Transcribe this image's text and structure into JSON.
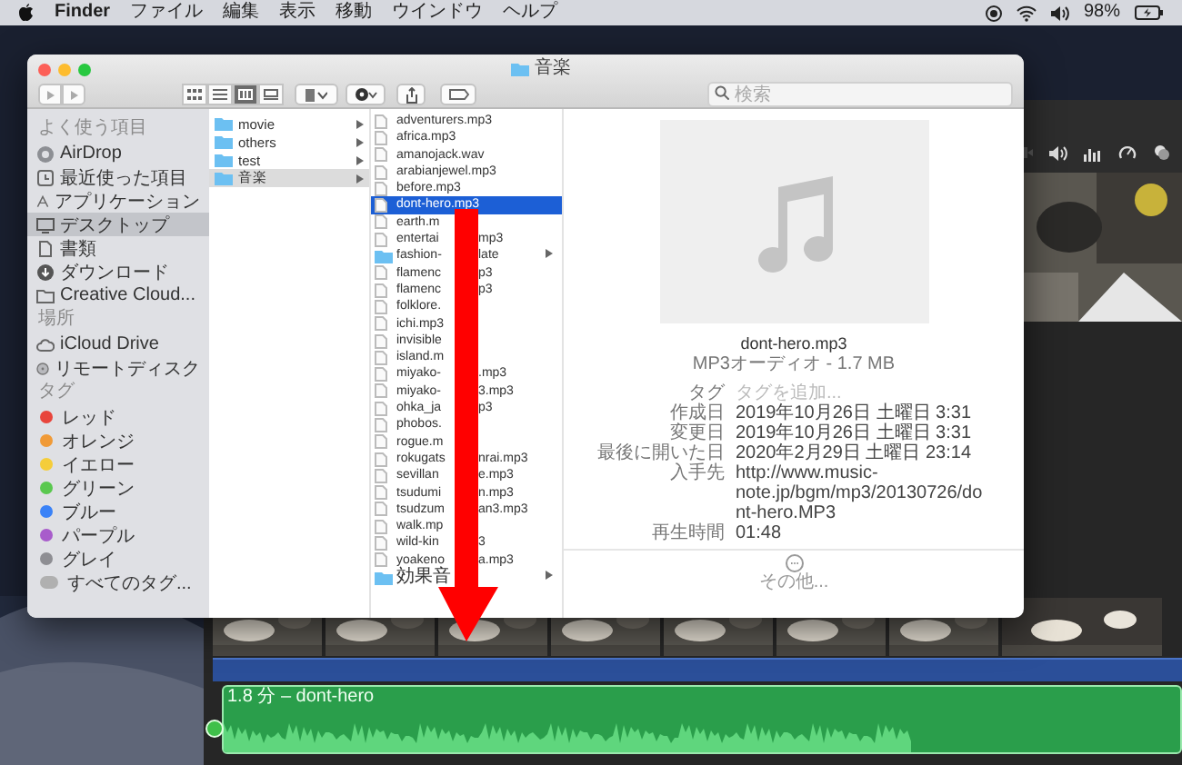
{
  "menubar": {
    "app": "Finder",
    "menus": [
      "ファイル",
      "編集",
      "表示",
      "移動",
      "ウインドウ",
      "ヘルプ"
    ],
    "battery": "98%"
  },
  "finder": {
    "title": "音楽",
    "view_buttons": [
      {
        "kind": "icons",
        "selected": false
      },
      {
        "kind": "list",
        "selected": false
      },
      {
        "kind": "columns",
        "selected": true
      },
      {
        "kind": "gallery",
        "selected": false
      }
    ],
    "search": {
      "placeholder": "検索"
    },
    "sidebar": [
      {
        "heading": "よく使う項目",
        "items": [
          {
            "label": "AirDrop",
            "kind": "airdrop",
            "selected": false
          },
          {
            "label": "最近使った項目",
            "kind": "recent",
            "selected": false
          },
          {
            "label": "アプリケーション",
            "kind": "apps",
            "selected": false
          },
          {
            "label": "デスクトップ",
            "kind": "desktop",
            "selected": true
          },
          {
            "label": "書類",
            "kind": "documents",
            "selected": false
          },
          {
            "label": "ダウンロード",
            "kind": "downloads",
            "selected": false
          },
          {
            "label": "Creative Cloud...",
            "kind": "folder",
            "selected": false
          }
        ]
      },
      {
        "heading": "場所",
        "items": [
          {
            "label": "iCloud Drive",
            "kind": "cloud",
            "selected": false
          },
          {
            "label": "リモートディスク",
            "kind": "disc",
            "selected": false
          }
        ]
      },
      {
        "heading": "タグ",
        "items": [
          {
            "label": "レッド",
            "kind": "tag",
            "color": "#e8453c",
            "selected": false
          },
          {
            "label": "オレンジ",
            "kind": "tag",
            "color": "#f09a37",
            "selected": false
          },
          {
            "label": "イエロー",
            "kind": "tag",
            "color": "#f5cd3a",
            "selected": false
          },
          {
            "label": "グリーン",
            "kind": "tag",
            "color": "#5ac84f",
            "selected": false
          },
          {
            "label": "ブルー",
            "kind": "tag",
            "color": "#3a82f7",
            "selected": false
          },
          {
            "label": "パープル",
            "kind": "tag",
            "color": "#a85ccb",
            "selected": false
          },
          {
            "label": "グレイ",
            "kind": "tag",
            "color": "#8e8e93",
            "selected": false
          },
          {
            "label": "すべてのタグ...",
            "kind": "all_tags",
            "selected": false
          }
        ]
      }
    ],
    "column_1": [
      {
        "name": "movie",
        "selected": false
      },
      {
        "name": "others",
        "selected": false
      },
      {
        "name": "test",
        "selected": false
      },
      {
        "name": "音楽",
        "selected": true
      }
    ],
    "column_2": [
      {
        "name": "adventurers.mp3",
        "kind": "audio",
        "selected": false
      },
      {
        "name": "africa.mp3",
        "kind": "audio",
        "selected": false
      },
      {
        "name": "amanojack.wav",
        "kind": "audio",
        "selected": false
      },
      {
        "name": "arabianjewel.mp3",
        "kind": "audio",
        "selected": false
      },
      {
        "name": "before.mp3",
        "kind": "audio",
        "selected": false
      },
      {
        "name": "dont-hero.mp3",
        "kind": "audio",
        "selected": true
      },
      {
        "name": "earth.m",
        "kind": "audio",
        "selected": false
      },
      {
        "name": "entertai",
        "tail": "mp3",
        "kind": "audio",
        "selected": false
      },
      {
        "name": "fashion-",
        "tail": "late",
        "kind": "folder",
        "selected": false
      },
      {
        "name": "flamenc",
        "tail": "p3",
        "kind": "audio",
        "selected": false
      },
      {
        "name": "flamenc",
        "tail": "p3",
        "kind": "audio",
        "selected": false
      },
      {
        "name": "folklore.",
        "kind": "audio",
        "selected": false
      },
      {
        "name": "ichi.mp3",
        "kind": "audio",
        "selected": false
      },
      {
        "name": "invisible",
        "kind": "audio",
        "selected": false
      },
      {
        "name": "island.m",
        "kind": "audio",
        "selected": false
      },
      {
        "name": "miyako-",
        "tail": ".mp3",
        "kind": "audio",
        "selected": false
      },
      {
        "name": "miyako-",
        "tail": "3.mp3",
        "kind": "audio",
        "selected": false
      },
      {
        "name": "ohka_ja",
        "tail": "p3",
        "kind": "audio",
        "selected": false
      },
      {
        "name": "phobos.",
        "kind": "audio",
        "selected": false
      },
      {
        "name": "rogue.m",
        "kind": "audio",
        "selected": false
      },
      {
        "name": "rokugats",
        "tail": "nrai.mp3",
        "kind": "audio",
        "selected": false
      },
      {
        "name": "sevillan",
        "tail": "e.mp3",
        "kind": "audio",
        "selected": false
      },
      {
        "name": "tsudumi",
        "tail": "n.mp3",
        "kind": "audio",
        "selected": false
      },
      {
        "name": "tsudzum",
        "tail": "an3.mp3",
        "kind": "audio",
        "selected": false
      },
      {
        "name": "walk.mp",
        "kind": "audio",
        "selected": false
      },
      {
        "name": "wild-kin",
        "tail": "3",
        "kind": "audio",
        "selected": false
      },
      {
        "name": "yoakeno",
        "tail": "a.mp3",
        "kind": "audio",
        "selected": false
      },
      {
        "name": "効果音",
        "kind": "folder",
        "selected": false
      }
    ],
    "preview": {
      "name": "dont-hero.mp3",
      "type": "MP3オーディオ - 1.7 MB",
      "tags": {
        "label": "タグ",
        "placeholder": "タグを追加..."
      },
      "details": [
        {
          "label": "作成日",
          "value": "2019年10月26日 土曜日 3:31"
        },
        {
          "label": "変更日",
          "value": "2019年10月26日 土曜日 3:31"
        },
        {
          "label": "最後に開いた日",
          "value": "2020年2月29日 土曜日 23:14"
        },
        {
          "label": "入手先",
          "value": "http://www.music-note.jp/bgm/mp3/20130726/dont-hero.MP3"
        },
        {
          "label": "再生時間",
          "value": "01:48"
        }
      ],
      "more": "その他..."
    }
  },
  "imovie": {
    "clip_label": "1.8 分 – dont-hero"
  }
}
